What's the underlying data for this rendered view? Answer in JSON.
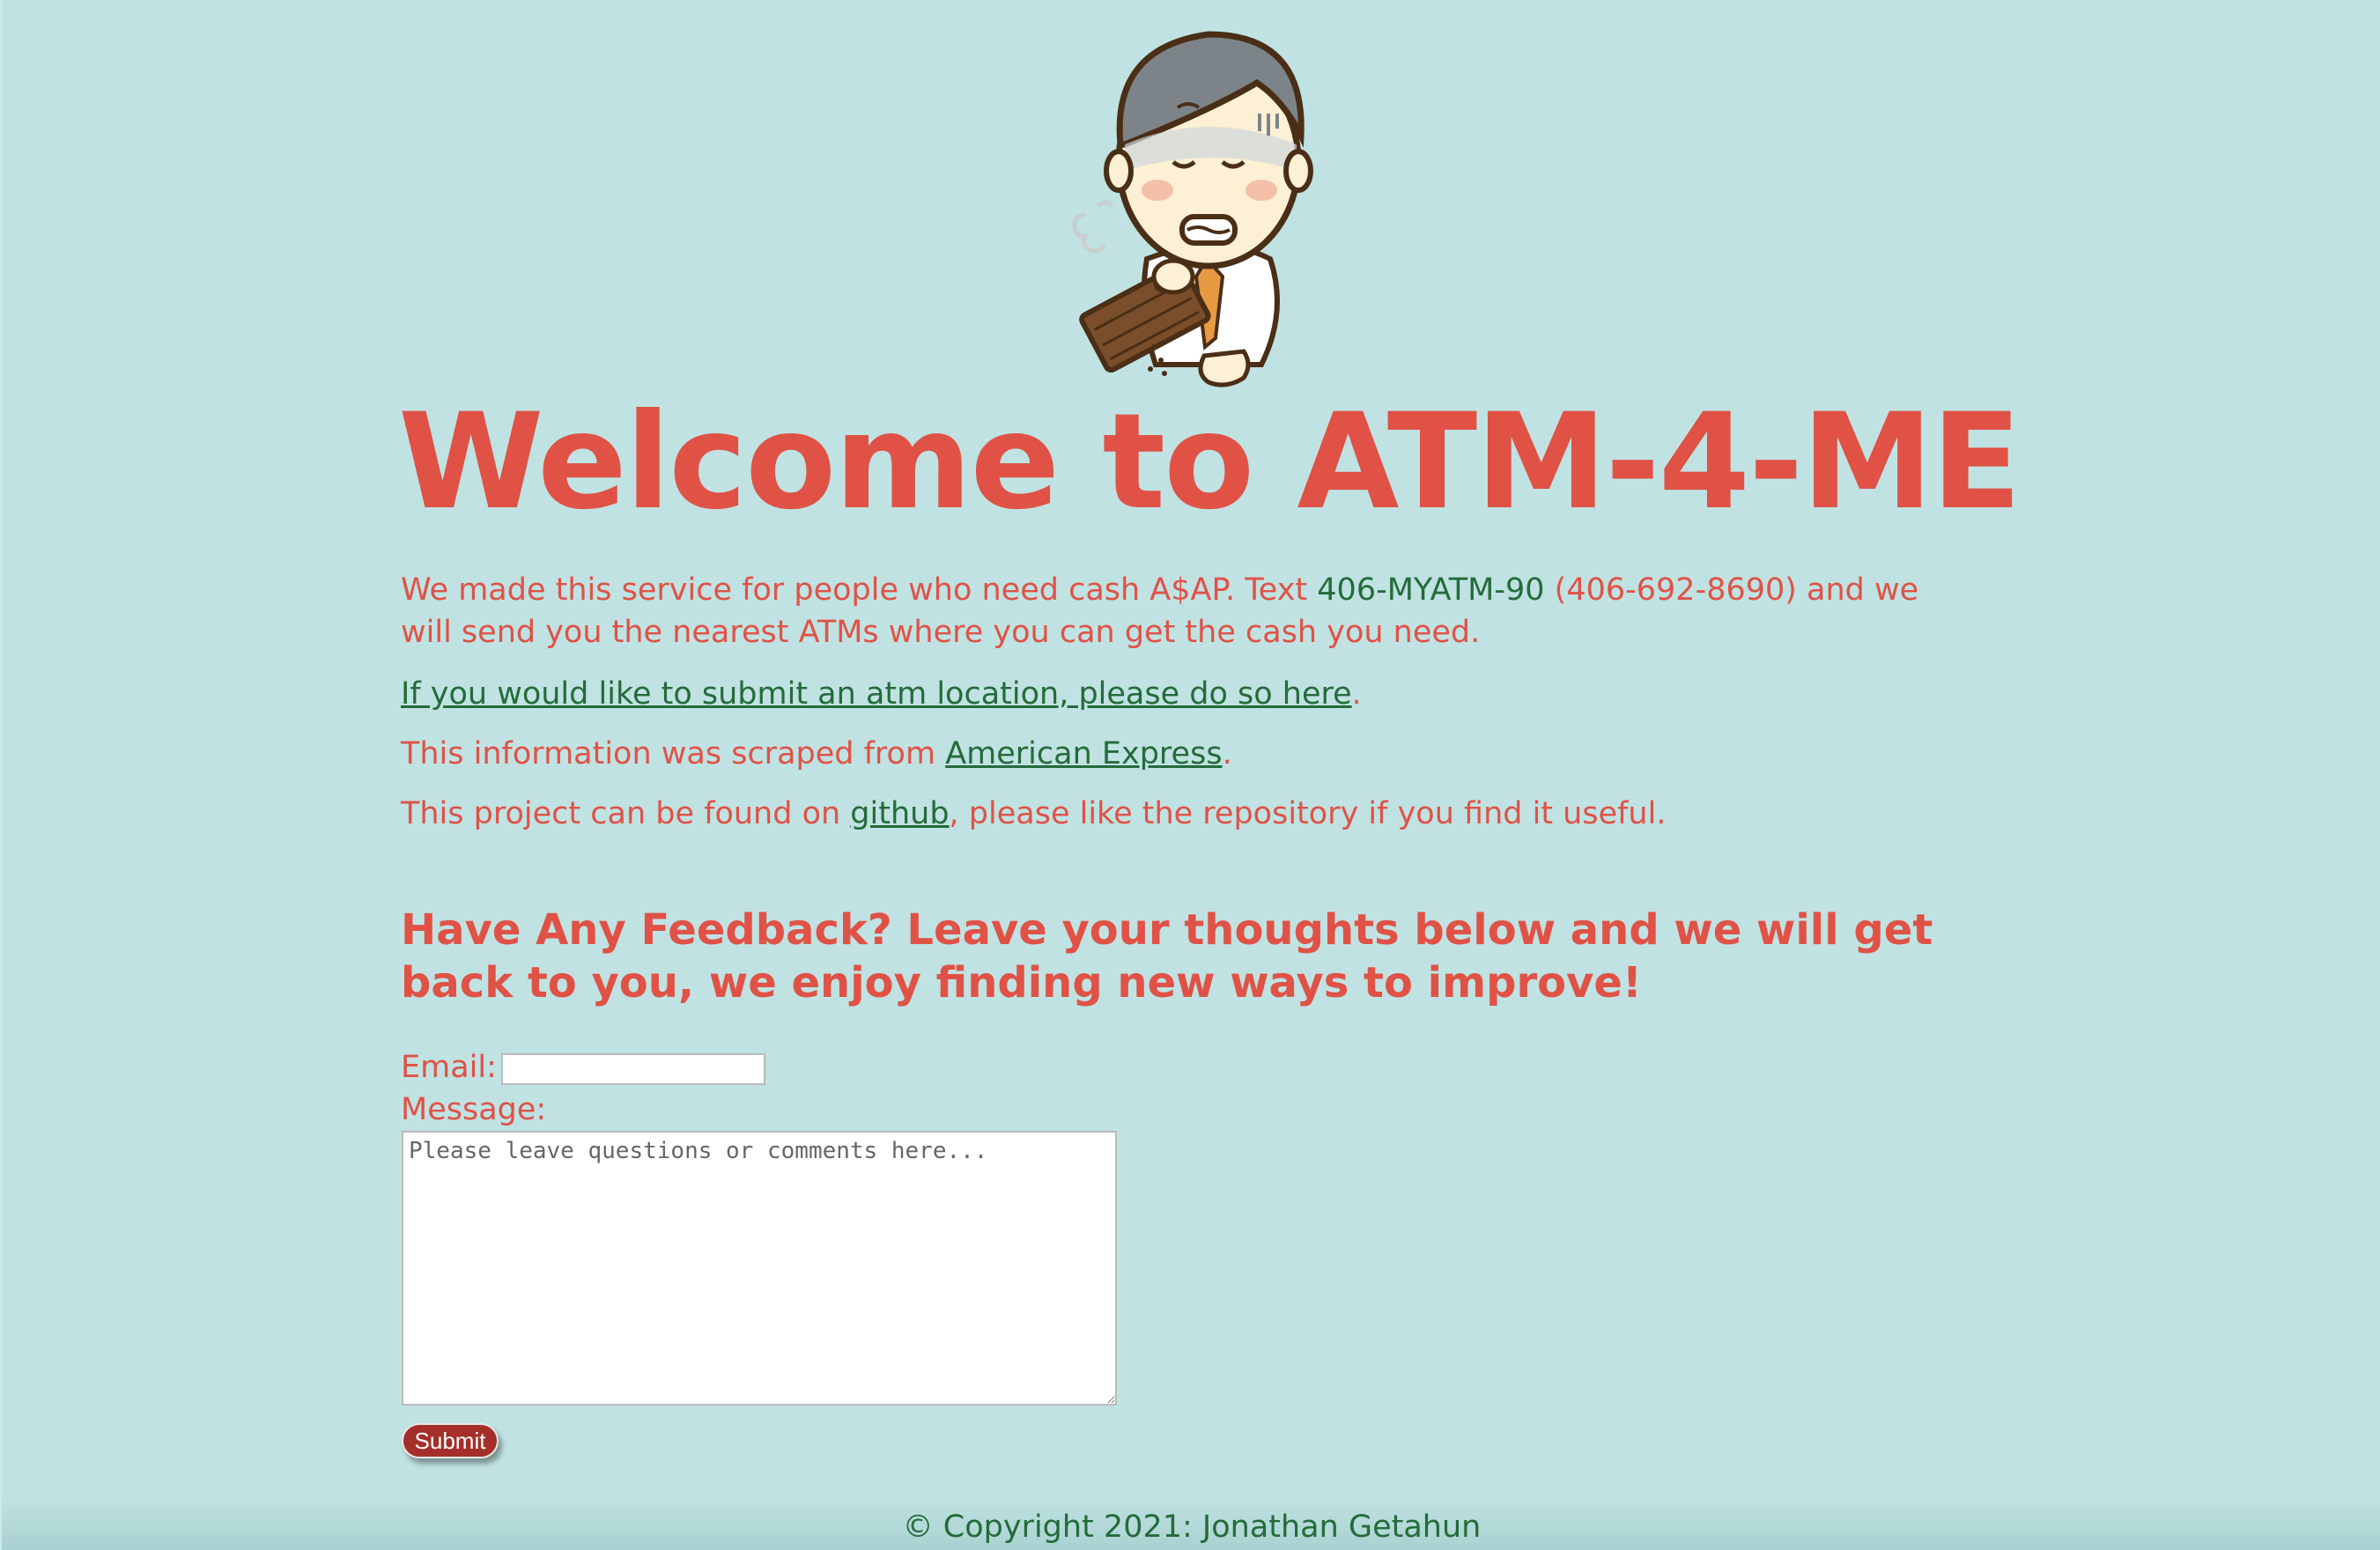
{
  "header": {
    "title": "Welcome to ATM-4-ME",
    "mascot": "man-with-empty-wallet-illustration"
  },
  "intro": {
    "p1_before": "We made this service for people who need cash A$AP. Text ",
    "p1_phone": "406-MYATM-90",
    "p1_after": " (406-692-8690) and we will send you the nearest ATMs where you can get the cash you need.",
    "submit_link": "If you would like to submit an atm location, please do so here",
    "submit_after": ".",
    "scraped_before": "This information was scraped from ",
    "scraped_link": "American Express",
    "scraped_after": ".",
    "github_before": "This project can be found on ",
    "github_link": "github",
    "github_after": ", please like the repository if you find it useful."
  },
  "feedback": {
    "title": "Have Any Feedback? Leave your thoughts below and we will get back to you, we enjoy finding new ways to improve!",
    "email_label": "Email:",
    "email_value": "",
    "message_label": "Message:",
    "message_placeholder": "Please leave questions or comments here...",
    "submit_label": "Submit"
  },
  "footer": {
    "copyright": "© Copyright 2021: Jonathan Getahun"
  },
  "colors": {
    "background": "#c0e2e2",
    "accent_red": "#e05246",
    "link_green": "#246b3a",
    "button": "#a42f2a"
  }
}
